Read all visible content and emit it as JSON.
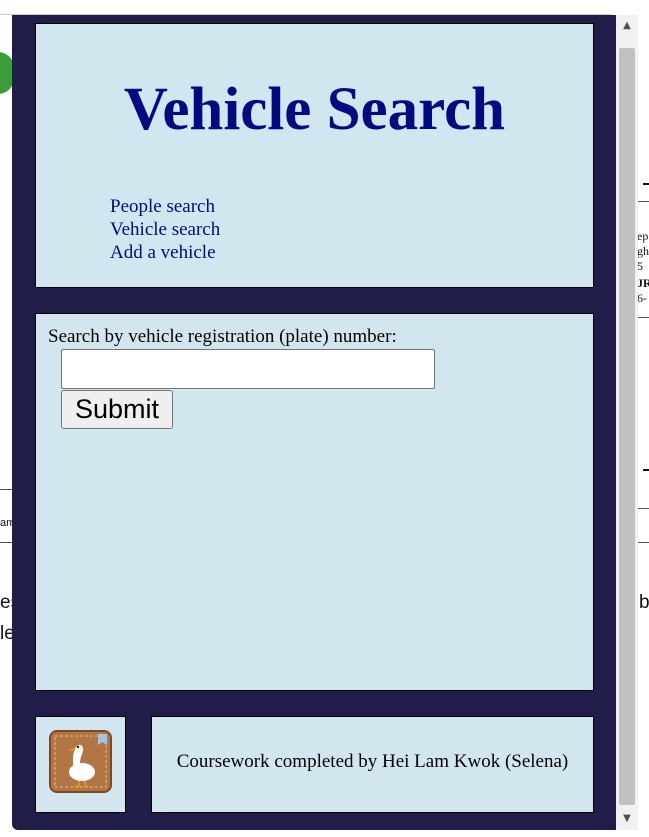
{
  "header": {
    "title": "Vehicle Search",
    "nav": [
      {
        "label": "People search"
      },
      {
        "label": "Vehicle search"
      },
      {
        "label": "Add a vehicle"
      }
    ]
  },
  "search": {
    "label": "Search by vehicle registration (plate) number:",
    "value": "",
    "placeholder": "",
    "submit_label": "Submit"
  },
  "footer": {
    "logo_icon": "goose-icon",
    "credit": "Coursework completed by Hei Lam Kwok (Selena)"
  },
  "background": {
    "fragments": [
      "ep",
      "gh",
      "5",
      "JR",
      "6-",
      "am",
      "es",
      "le",
      "b"
    ]
  },
  "colors": {
    "window_bg": "#201d49",
    "panel_bg": "#d1e6ef",
    "title_color": "#000b82"
  }
}
